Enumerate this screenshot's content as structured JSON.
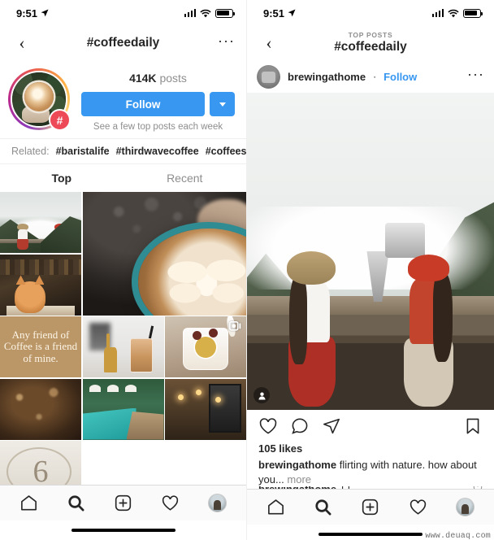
{
  "status_bar": {
    "time": "9:51",
    "location_icon": "location-arrow-icon",
    "signal_icon": "cellular-signal-icon",
    "wifi_icon": "wifi-icon",
    "battery_icon": "battery-icon"
  },
  "left_screen": {
    "nav": {
      "back_icon": "chevron-left-icon",
      "title": "#coffeedaily",
      "more_icon": "ellipsis-icon"
    },
    "profile": {
      "avatar_alt": "hashtag-avatar",
      "hash_badge": "#",
      "posts_value": "414K",
      "posts_label": "posts",
      "follow_label": "Follow",
      "caret_icon": "chevron-down-icon",
      "note": "See a few top posts each week",
      "accent_color": "#3897f0",
      "badge_color": "#ed4956"
    },
    "related": {
      "label": "Related:",
      "tags": [
        "#baristalife",
        "#thirdwavecoffee",
        "#coffeesho"
      ]
    },
    "tabs": [
      {
        "label": "Top",
        "active": true
      },
      {
        "label": "Recent",
        "active": false
      }
    ],
    "grid": [
      {
        "name": "tile-mountains-coffee",
        "kind": "mountains",
        "multi": false
      },
      {
        "name": "tile-latte-art",
        "kind": "latte",
        "big": true,
        "multi": false
      },
      {
        "name": "tile-cat-books",
        "kind": "cat",
        "multi": false
      },
      {
        "name": "tile-coffee-quote",
        "kind": "quote",
        "text": "Any friend of Coffee is a friend of mine.",
        "multi": false
      },
      {
        "name": "tile-iced-coffee-giraffe",
        "kind": "iced",
        "multi": false
      },
      {
        "name": "tile-dessert-jar",
        "kind": "jar",
        "multi": true
      },
      {
        "name": "tile-warm-bokeh",
        "kind": "bokeh2",
        "multi": false
      },
      {
        "name": "tile-poolside",
        "kind": "pool",
        "multi": false
      },
      {
        "name": "tile-cafe-interior",
        "kind": "cafe",
        "multi": false
      },
      {
        "name": "tile-number-six",
        "kind": "six",
        "text": "6",
        "multi": false
      }
    ]
  },
  "right_screen": {
    "nav": {
      "back_icon": "chevron-left-icon",
      "eyebrow": "TOP POSTS",
      "title": "#coffeedaily"
    },
    "post": {
      "avatar_alt": "user-avatar",
      "username": "brewingathome",
      "separator": "·",
      "follow_label": "Follow",
      "more_icon": "ellipsis-icon",
      "photo_alt": "two-women-brewing-coffee-on-mountain-deck",
      "tag_icon": "person-tag-icon",
      "like_icon": "heart-icon",
      "comment_icon": "comment-icon",
      "share_icon": "share-icon",
      "save_icon": "bookmark-icon",
      "likes": "105 likes",
      "caption_user": "brewingathome",
      "caption_text": "flirting with nature. how about you...",
      "caption_more": "more",
      "comment_user": "brewingathome",
      "comment_text": "[  ]"
    }
  },
  "tabbar": {
    "items": [
      {
        "name": "home",
        "icon": "home-icon",
        "active": false
      },
      {
        "name": "search",
        "icon": "search-icon",
        "active": true
      },
      {
        "name": "create",
        "icon": "plus-square-icon",
        "active": false
      },
      {
        "name": "activity",
        "icon": "heart-icon",
        "active": false
      },
      {
        "name": "profile",
        "icon": "profile-avatar-icon",
        "active": false
      }
    ]
  },
  "watermark": "www.deuaq.com"
}
